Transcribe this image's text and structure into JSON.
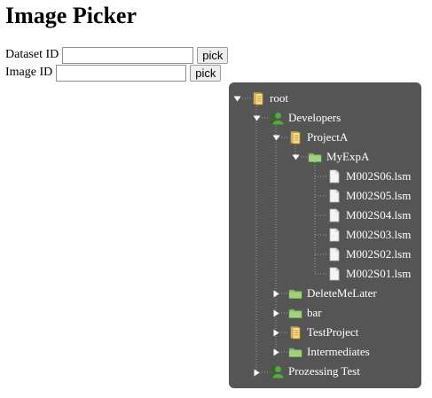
{
  "page": {
    "title": "Image Picker"
  },
  "form": {
    "dataset": {
      "label": "Dataset ID",
      "value": "",
      "button": "pick"
    },
    "image": {
      "label": "Image ID",
      "value": "",
      "button": "pick"
    }
  },
  "tree": {
    "root": {
      "label": "root",
      "icon": "project-icon"
    },
    "developers": {
      "label": "Developers",
      "icon": "user-icon"
    },
    "project_a": {
      "label": "ProjectA",
      "icon": "project-icon"
    },
    "my_exp_a": {
      "label": "MyExpA",
      "icon": "dataset-folder-icon"
    },
    "files": [
      {
        "label": "M002S06.lsm",
        "icon": "image-file-icon"
      },
      {
        "label": "M002S05.lsm",
        "icon": "image-file-icon"
      },
      {
        "label": "M002S04.lsm",
        "icon": "image-file-icon"
      },
      {
        "label": "M002S03.lsm",
        "icon": "image-file-icon"
      },
      {
        "label": "M002S02.lsm",
        "icon": "image-file-icon"
      },
      {
        "label": "M002S01.lsm",
        "icon": "image-file-icon"
      }
    ],
    "delete_me_later": {
      "label": "DeleteMeLater",
      "icon": "dataset-folder-icon"
    },
    "bar": {
      "label": "bar",
      "icon": "dataset-folder-icon"
    },
    "test_project": {
      "label": "TestProject",
      "icon": "project-icon"
    },
    "intermediates": {
      "label": "Intermediates",
      "icon": "dataset-folder-icon"
    },
    "prozessing_test": {
      "label": "Prozessing Test",
      "icon": "user-icon"
    }
  },
  "colors": {
    "panel_bg": "#555555",
    "tree_text": "#ffffff",
    "folder_green": "#8fc06a",
    "project_yellow": "#f3d27a",
    "user_green": "#3d7d2c"
  }
}
